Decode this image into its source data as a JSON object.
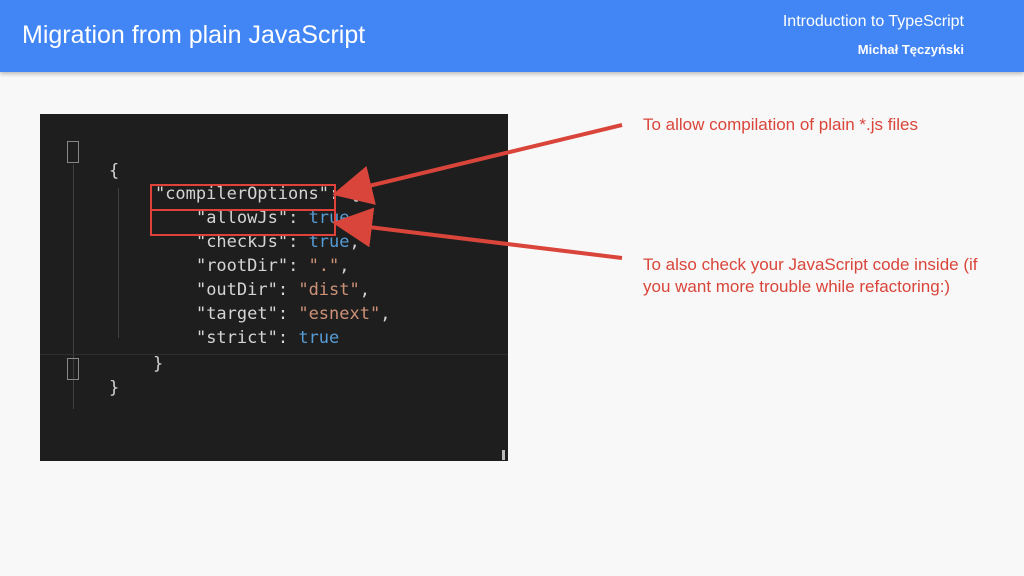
{
  "header": {
    "title": "Migration from plain JavaScript",
    "course": "Introduction to TypeScript",
    "author": "Michał Tęczyński"
  },
  "code": {
    "open_brace": "{",
    "compiler_options_key": "\"compilerOptions\"",
    "colon_open": ": {",
    "lines": [
      {
        "key": "\"allowJs\"",
        "value": "true",
        "value_kind": "keyword"
      },
      {
        "key": "\"checkJs\"",
        "value": "true",
        "value_kind": "keyword"
      },
      {
        "key": "\"rootDir\"",
        "value": "\".\"",
        "value_kind": "string"
      },
      {
        "key": "\"outDir\"",
        "value": "\"dist\"",
        "value_kind": "string"
      },
      {
        "key": "\"target\"",
        "value": "\"esnext\"",
        "value_kind": "string"
      },
      {
        "key": "\"strict\"",
        "value": "true",
        "value_kind": "keyword"
      }
    ],
    "inner_close": "}",
    "close_brace": "}",
    "colon": ": ",
    "comma": ","
  },
  "annotations": {
    "allow_js": "To allow compilation of plain *.js files",
    "check_js": "To also check your JavaScript code inside (if you want more trouble while refactoring:)"
  },
  "colors": {
    "header_bg": "#4285f4",
    "annotation": "#d9453a",
    "arrow": "#d9453a",
    "code_bg": "#1e1e1e"
  }
}
